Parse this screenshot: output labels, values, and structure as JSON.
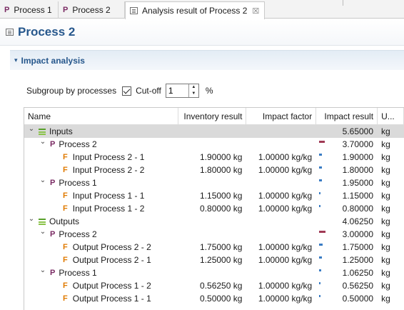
{
  "tabs": [
    {
      "label": "Process 1",
      "icon": "process-icon"
    },
    {
      "label": "Process 2",
      "icon": "process-icon"
    },
    {
      "label": "Analysis result of Process 2",
      "icon": "result-editor-icon",
      "close": "☒"
    }
  ],
  "form": {
    "title": "Process 2",
    "icon": "result-editor-icon"
  },
  "section": {
    "title": "Impact analysis",
    "toggle": "▾"
  },
  "controls": {
    "subgroup_label": "Subgroup by processes",
    "subgroup_checked": true,
    "cutoff_label": "Cut-off",
    "cutoff_value": "1",
    "percent": "%"
  },
  "table": {
    "headers": {
      "name": "Name",
      "inventory": "Inventory result",
      "factor": "Impact factor",
      "result": "Impact result",
      "unit": "U..."
    },
    "bar_colors": {
      "red": "#a03a55",
      "blue": "#3a7cc4"
    },
    "rows": [
      {
        "level": 0,
        "kind": "category",
        "name": "Inputs",
        "expanded": true,
        "inventory": "",
        "factor": "",
        "result": "5.65000",
        "unit": "kg",
        "bar": null,
        "selected": true
      },
      {
        "level": 1,
        "kind": "process",
        "name": "Process 2",
        "expanded": true,
        "inventory": "",
        "factor": "",
        "result": "3.70000",
        "unit": "kg",
        "bar": {
          "color": "red",
          "share": 0.655
        }
      },
      {
        "level": 2,
        "kind": "flow",
        "name": "Input Process 2 - 1",
        "inventory": "1.90000 kg",
        "factor": "1.00000 kg/kg",
        "result": "1.90000",
        "unit": "kg",
        "bar": {
          "color": "blue",
          "share": 0.336
        }
      },
      {
        "level": 2,
        "kind": "flow",
        "name": "Input Process 2 - 2",
        "inventory": "1.80000 kg",
        "factor": "1.00000 kg/kg",
        "result": "1.80000",
        "unit": "kg",
        "bar": {
          "color": "blue",
          "share": 0.319
        }
      },
      {
        "level": 1,
        "kind": "process",
        "name": "Process 1",
        "expanded": true,
        "inventory": "",
        "factor": "",
        "result": "1.95000",
        "unit": "kg",
        "bar": {
          "color": "blue",
          "share": 0.345
        }
      },
      {
        "level": 2,
        "kind": "flow",
        "name": "Input Process 1 - 1",
        "inventory": "1.15000 kg",
        "factor": "1.00000 kg/kg",
        "result": "1.15000",
        "unit": "kg",
        "bar": {
          "color": "blue",
          "share": 0.204
        }
      },
      {
        "level": 2,
        "kind": "flow",
        "name": "Input Process 1 - 2",
        "inventory": "0.80000 kg",
        "factor": "1.00000 kg/kg",
        "result": "0.80000",
        "unit": "kg",
        "bar": {
          "color": "blue",
          "share": 0.142
        }
      },
      {
        "level": 0,
        "kind": "category",
        "name": "Outputs",
        "expanded": true,
        "inventory": "",
        "factor": "",
        "result": "4.06250",
        "unit": "kg",
        "bar": null
      },
      {
        "level": 1,
        "kind": "process",
        "name": "Process 2",
        "expanded": true,
        "inventory": "",
        "factor": "",
        "result": "3.00000",
        "unit": "kg",
        "bar": {
          "color": "red",
          "share": 0.738
        }
      },
      {
        "level": 2,
        "kind": "flow",
        "name": "Output Process 2 - 2",
        "inventory": "1.75000 kg",
        "factor": "1.00000 kg/kg",
        "result": "1.75000",
        "unit": "kg",
        "bar": {
          "color": "blue",
          "share": 0.431
        }
      },
      {
        "level": 2,
        "kind": "flow",
        "name": "Output Process 2 - 1",
        "inventory": "1.25000 kg",
        "factor": "1.00000 kg/kg",
        "result": "1.25000",
        "unit": "kg",
        "bar": {
          "color": "blue",
          "share": 0.308
        }
      },
      {
        "level": 1,
        "kind": "process",
        "name": "Process 1",
        "expanded": true,
        "inventory": "",
        "factor": "",
        "result": "1.06250",
        "unit": "kg",
        "bar": {
          "color": "blue",
          "share": 0.262
        }
      },
      {
        "level": 2,
        "kind": "flow",
        "name": "Output Process 1 - 2",
        "inventory": "0.56250 kg",
        "factor": "1.00000 kg/kg",
        "result": "0.56250",
        "unit": "kg",
        "bar": {
          "color": "blue",
          "share": 0.138
        }
      },
      {
        "level": 2,
        "kind": "flow",
        "name": "Output Process 1 - 1",
        "inventory": "0.50000 kg",
        "factor": "1.00000 kg/kg",
        "result": "0.50000",
        "unit": "kg",
        "bar": {
          "color": "blue",
          "share": 0.123
        }
      }
    ]
  }
}
